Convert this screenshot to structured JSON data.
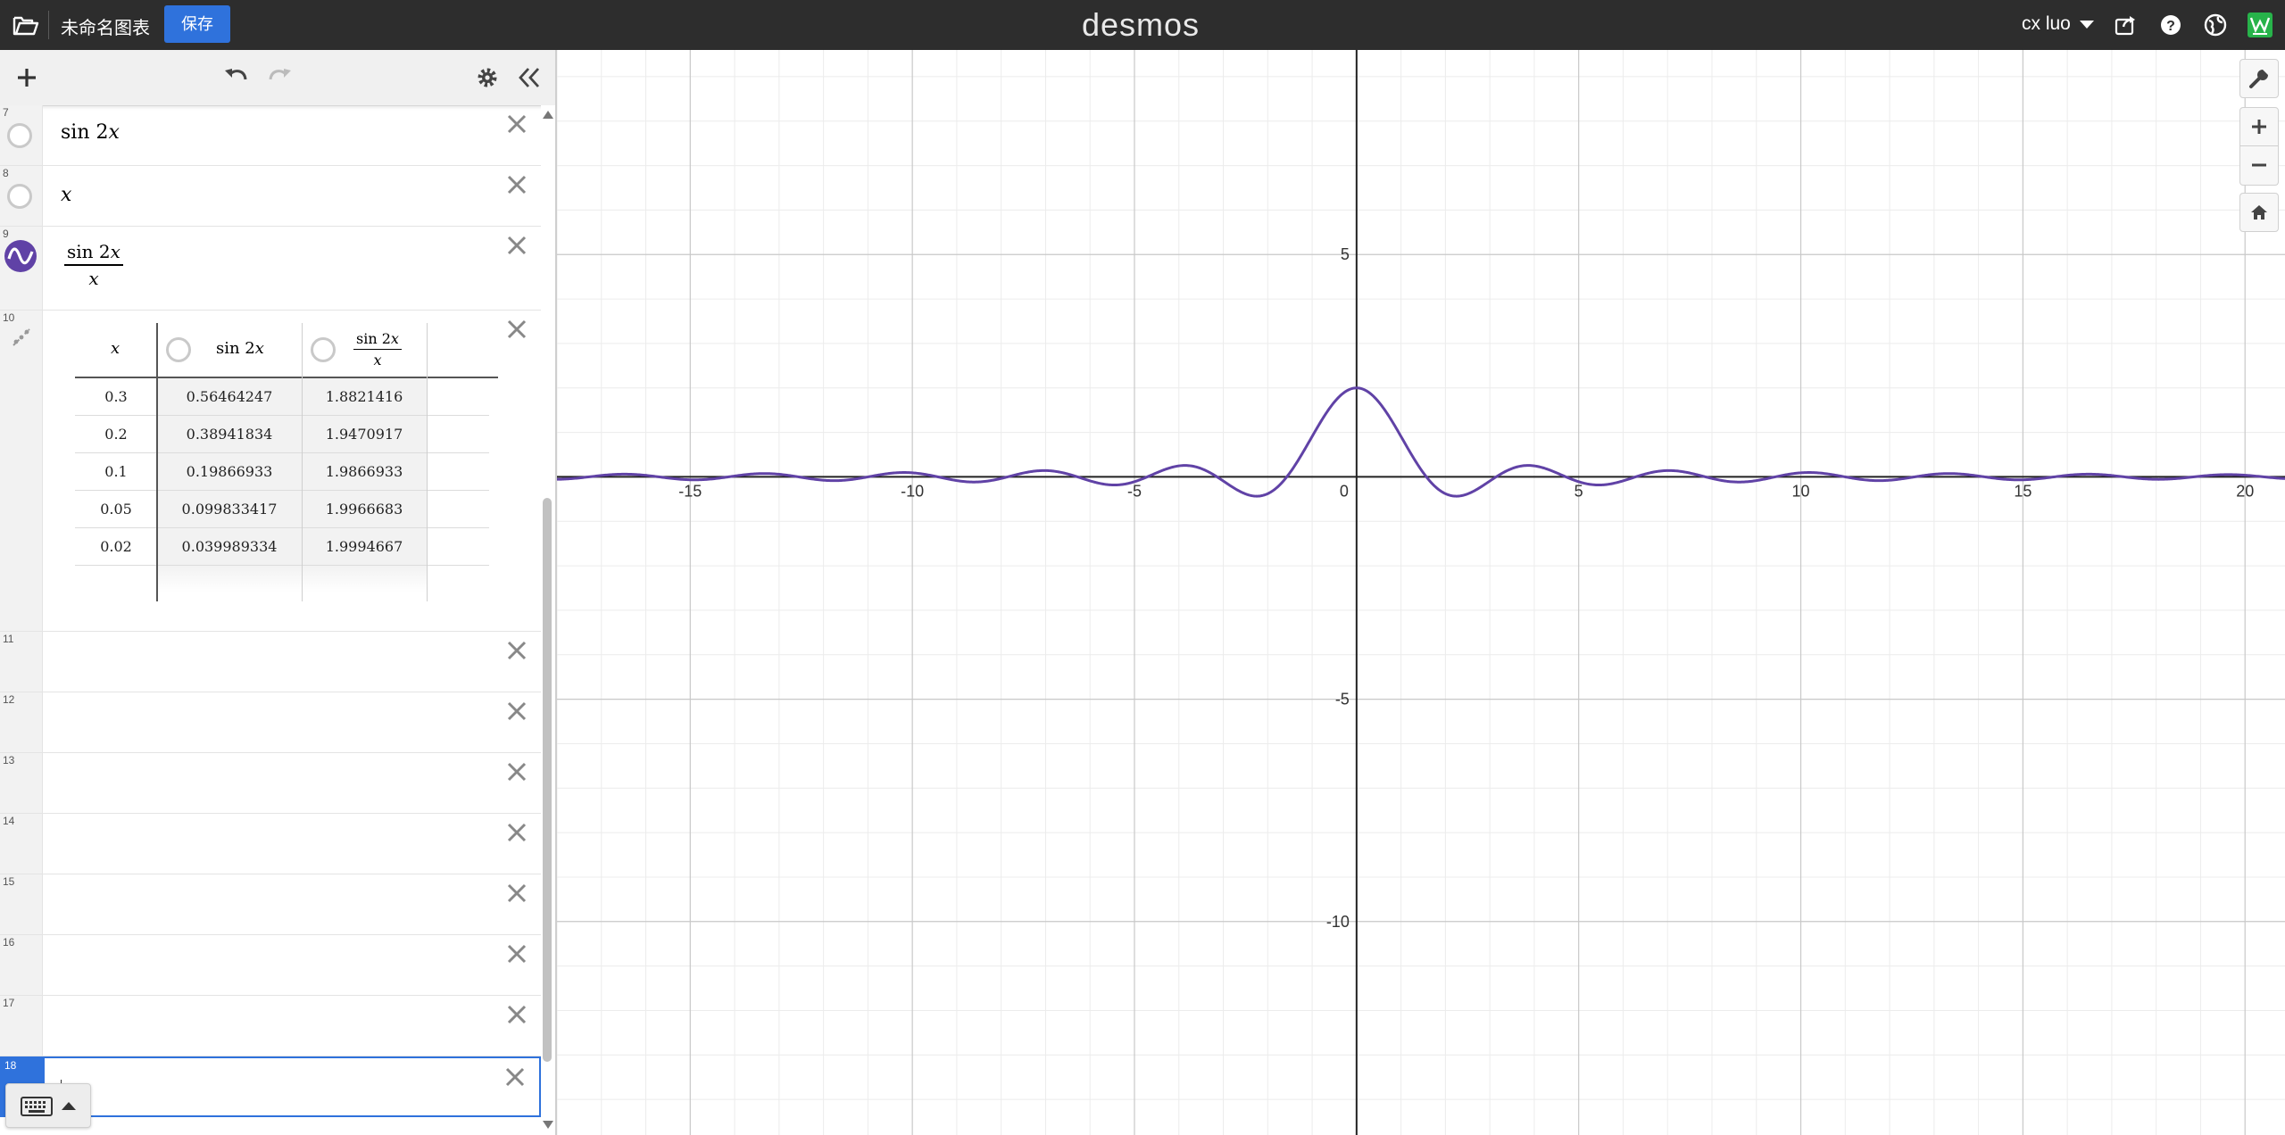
{
  "header": {
    "graph_title": "未命名图表",
    "save_label": "保存",
    "brand": "desmos",
    "user_name": "cx luo",
    "icons": [
      "folder-icon",
      "share-icon",
      "help-icon",
      "language-icon",
      "profile-icon"
    ]
  },
  "toolbar": {
    "icons": [
      "add-icon",
      "undo-icon",
      "redo-icon",
      "gear-icon",
      "collapse-panel-icon"
    ]
  },
  "expressions": [
    {
      "num": "7",
      "latex": "sin 2x"
    },
    {
      "num": "8",
      "latex": "x"
    },
    {
      "num": "9",
      "latex": "sin 2x / x",
      "color": "#6042a6"
    },
    {
      "num": "10",
      "type": "table"
    },
    {
      "num": "11"
    },
    {
      "num": "12"
    },
    {
      "num": "13"
    },
    {
      "num": "14"
    },
    {
      "num": "15"
    },
    {
      "num": "16"
    },
    {
      "num": "17"
    },
    {
      "num": "18",
      "active": true
    }
  ],
  "table": {
    "headers": [
      "x",
      "sin 2x",
      "sin 2x / x"
    ],
    "rows": [
      [
        "0.3",
        "0.56464247",
        "1.8821416"
      ],
      [
        "0.2",
        "0.38941834",
        "1.9470917"
      ],
      [
        "0.1",
        "0.19866933",
        "1.9866933"
      ],
      [
        "0.05",
        "0.099833417",
        "1.9966683"
      ],
      [
        "0.02",
        "0.039989334",
        "1.9994667"
      ]
    ]
  },
  "graph_controls": [
    "wrench-icon",
    "zoom-in-icon",
    "zoom-out-icon",
    "home-icon"
  ],
  "chart_data": {
    "type": "line",
    "title": "",
    "xlabel": "",
    "ylabel": "",
    "xlim": [
      -18,
      20.9
    ],
    "ylim": [
      -14.8,
      9.6
    ],
    "x_ticks": [
      "-15",
      "-10",
      "-5",
      "0",
      "5",
      "10",
      "15",
      "20"
    ],
    "y_ticks": [
      "5",
      "-5",
      "-10"
    ],
    "grid": true,
    "series": [
      {
        "function": "sin 2x / x",
        "color": "#6042a6",
        "x": [
          -18,
          -16,
          -14,
          -12,
          -10,
          -8,
          -6,
          -4,
          -3.5,
          -3,
          -2.5,
          -2,
          -1.5,
          -1,
          -0.5,
          0,
          0.5,
          1,
          1.5,
          2,
          2.5,
          3,
          3.5,
          4,
          6,
          8,
          10,
          12,
          14,
          16,
          18,
          20
        ],
        "y": [
          0.055,
          -0.034,
          0.019,
          0.076,
          -0.091,
          -0.036,
          0.089,
          0.247,
          0.187,
          -0.093,
          -0.38,
          -0.378,
          0.094,
          0.909,
          1.683,
          2,
          1.683,
          0.909,
          0.094,
          -0.378,
          -0.38,
          -0.093,
          0.187,
          0.247,
          -0.089,
          -0.036,
          0.091,
          0.076,
          0.019,
          -0.034,
          -0.055,
          0.037
        ]
      }
    ]
  }
}
